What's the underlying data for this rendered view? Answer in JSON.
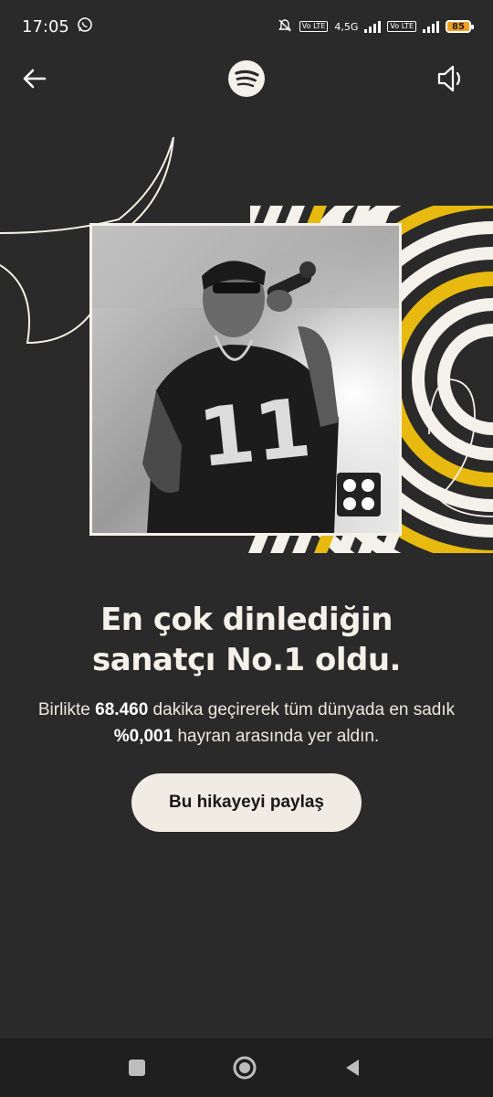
{
  "status_bar": {
    "time": "17:05",
    "network_label": "4,5G",
    "volte_label_1": "Vo LTE",
    "volte_label_2": "Vo LTE",
    "battery_level": "85",
    "icons": [
      "whatsapp-icon",
      "mute-icon",
      "signal-icon",
      "battery-icon"
    ]
  },
  "topbar": {
    "back_icon": "arrow-left-icon",
    "logo_icon": "spotify-logo-icon",
    "sound_icon": "speaker-icon"
  },
  "colors": {
    "background": "#2a2a2a",
    "accent_yellow": "#e8b90f",
    "cream": "#f4f1ea",
    "button_bg": "#f0ece4"
  },
  "story": {
    "headline_line1": "En çok dinlediğin",
    "headline_line2": "sanatçı No.1 oldu.",
    "sub_part1": "Birlikte ",
    "minutes": "68.460",
    "sub_part2": " dakika geçirerek tüm dünyada en sadık ",
    "percentile": "%0,001",
    "sub_part3": " hayran arasında yer aldın.",
    "share_label": "Bu hikayeyi paylaş"
  },
  "navbar": {
    "icons": [
      "recents-square-icon",
      "home-circle-icon",
      "back-triangle-icon"
    ]
  }
}
